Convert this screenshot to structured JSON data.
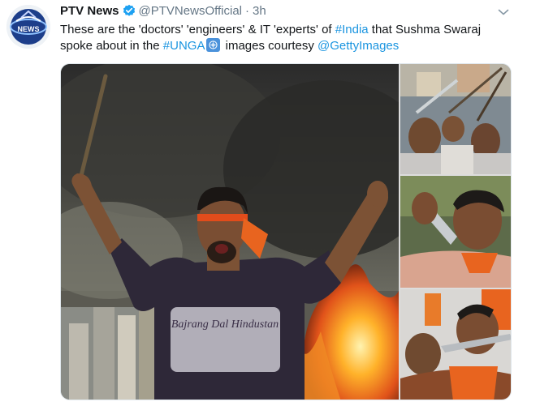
{
  "account": {
    "name": "PTV News",
    "handle": "@PTVNewsOfficial",
    "separator": "·",
    "time": "3h",
    "avatar_text": "NEWS"
  },
  "tweet": {
    "text_part1": "These are the 'doctors' 'engineers' & IT 'experts' of ",
    "hashtag_india": "#India",
    "text_part2": " that Sushma Swaraj spoke about in the ",
    "hashtag_unga": "#UNGA",
    "text_part3": " images courtesy ",
    "mention": "@GettyImages"
  },
  "main_photo": {
    "shirt_text": "Bajrang Dal Hindustan"
  },
  "icons": {
    "verified": "verified-badge-icon",
    "caret": "chevron-down-icon",
    "un_flag": "un-flag-emoji"
  },
  "colors": {
    "link": "#1b95e0",
    "verified": "#1da1f2",
    "muted": "#657786"
  }
}
